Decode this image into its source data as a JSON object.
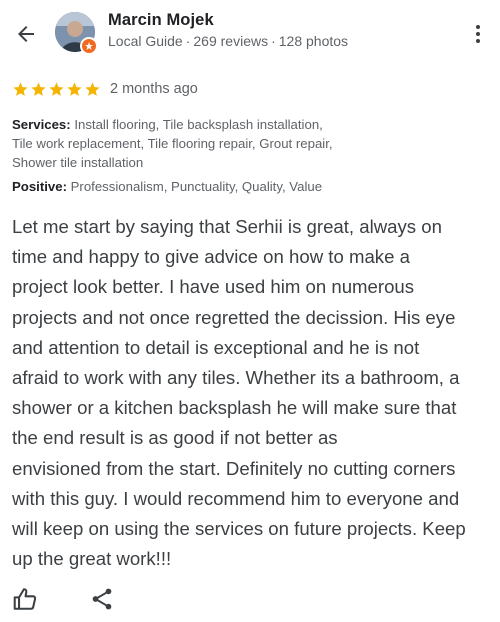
{
  "reviewer": {
    "name": "Marcin Mojek",
    "badge": "Local Guide",
    "reviews": "269 reviews",
    "photos": "128 photos",
    "separator": "·"
  },
  "rating": {
    "stars": 5,
    "max": 5,
    "date": "2 months ago",
    "star_color": "#f4b400"
  },
  "services": {
    "label": "Services:",
    "lines": [
      " Install flooring, Tile backsplash installation,",
      "Tile work replacement, Tile flooring repair, Grout repair,",
      "Shower tile installation"
    ]
  },
  "positive": {
    "label": "Positive:",
    "value": " Professionalism, Punctuality, Quality, Value"
  },
  "review": {
    "lines": [
      "Let me start by saying that Serhii is great, always on",
      "time and happy to give advice on how to make a",
      "project look better. I have used him on numerous",
      "projects and not once regretted the decission. His eye",
      "and attention to detail is exceptional and he is not",
      "afraid to work with any tiles. Whether its a bathroom, a",
      "shower or a kitchen backsplash he will make sure that",
      "the end result is as good if not better as",
      "envisioned from the start. Definitely no cutting corners",
      "with this guy. I would recommend him to everyone and",
      "will keep on using the services on future projects. Keep",
      "up the great work!!!"
    ]
  },
  "icons": {
    "back": "arrow-back-icon",
    "more": "more-vert-icon",
    "like": "thumbs-up-icon",
    "share": "share-icon",
    "badge": "local-guide-badge-icon"
  },
  "colors": {
    "text_primary": "#202124",
    "text_secondary": "#5f6368",
    "body_text": "#3c4043",
    "guide_badge": "#f26a21"
  }
}
